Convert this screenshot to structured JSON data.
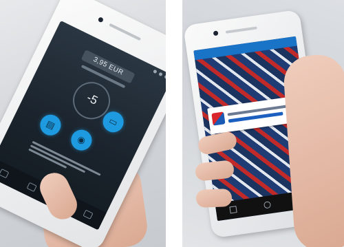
{
  "left_panel": {
    "balance_value": "3,95 EUR",
    "temperature_value": "-5"
  },
  "right_panel": {},
  "colors": {
    "accent_button": "#1e9be0",
    "dark_screen": "#1a232c",
    "banner_blue": "#1b5fbf",
    "banner_red": "#d8262b"
  },
  "icons": [
    "battery-icon",
    "lightbulb-icon",
    "charging-icon",
    "home-nav-icon"
  ]
}
